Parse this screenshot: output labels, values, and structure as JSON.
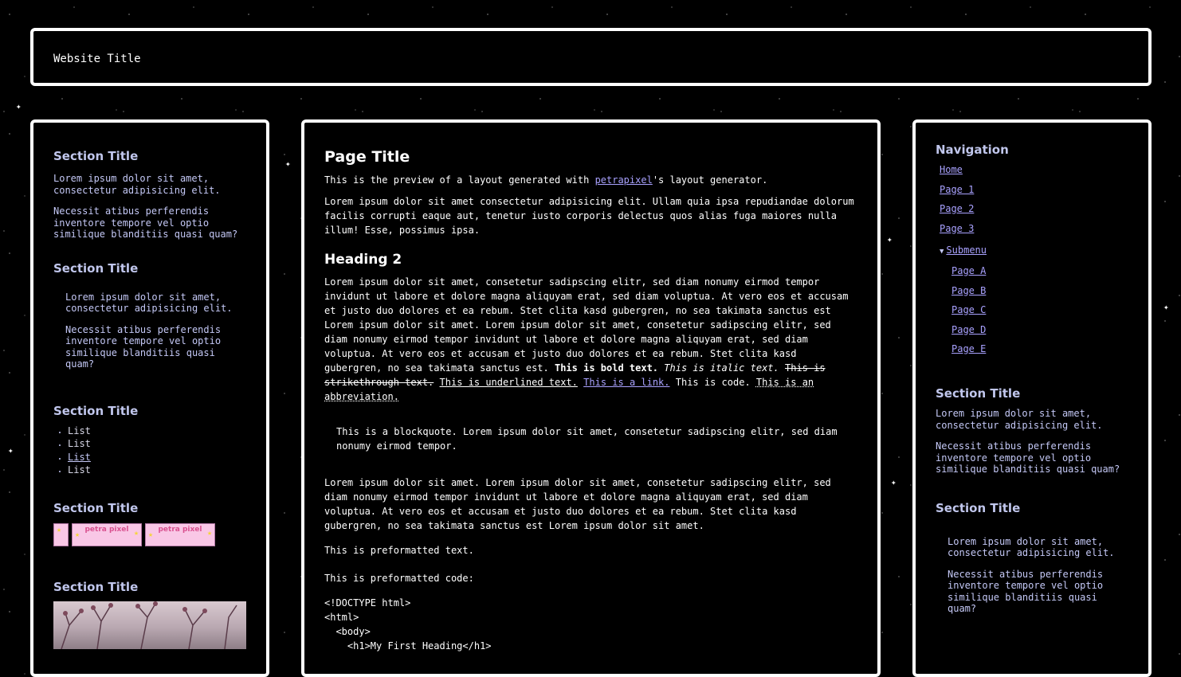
{
  "header": {
    "site_title": "Website Title"
  },
  "left": {
    "s1": {
      "title": "Section Title",
      "p1": "Lorem ipsum dolor sit amet, consectetur adipisicing elit.",
      "p2": "Necessit atibus perferendis inventore tempore vel optio similique blanditiis quasi quam?"
    },
    "s2": {
      "title": "Section Title",
      "p1": "Lorem ipsum dolor sit amet, consectetur adipisicing elit.",
      "p2": "Necessit atibus perferendis inventore tempore vel optio similique blanditiis quasi quam?"
    },
    "s3": {
      "title": "Section Title",
      "items": [
        "List",
        "List",
        "List",
        "List"
      ]
    },
    "s4": {
      "title": "Section Title",
      "buttons": [
        "petra pixel",
        "petra pixel"
      ]
    },
    "s5": {
      "title": "Section Title"
    }
  },
  "main": {
    "page_title": "Page Title",
    "intro_before": "This is the preview of a layout generated with ",
    "intro_link": "petrapixel",
    "intro_after": "'s layout generator.",
    "p1": "Lorem ipsum dolor sit amet consectetur adipisicing elit. Ullam quia ipsa repudiandae dolorum facilis corrupti eaque aut, tenetur iusto corporis delectus quos alias fuga maiores nulla illum! Esse, possimus ipsa.",
    "heading2": "Heading 2",
    "p2_plain": "Lorem ipsum dolor sit amet, consetetur sadipscing elitr, sed diam nonumy eirmod tempor invidunt ut labore et dolore magna aliquyam erat, sed diam voluptua. At vero eos et accusam et justo duo dolores et ea rebum. Stet clita kasd gubergren, no sea takimata sanctus est Lorem ipsum dolor sit amet. Lorem ipsum dolor sit amet, consetetur sadipscing elitr, sed diam nonumy eirmod tempor invidunt ut labore et dolore magna aliquyam erat, sed diam voluptua. At vero eos et accusam et justo duo dolores et ea rebum. Stet clita kasd gubergren, no sea takimata sanctus est. ",
    "bold": "This is bold text.",
    "italic": "This is italic text.",
    "strike": "This is strikethrough text.",
    "underline": "This is underlined text.",
    "link": "This is a link.",
    "code": "This is code.",
    "abbr": "This is an abbreviation.",
    "blockquote": "This is a blockquote. Lorem ipsum dolor sit amet, consetetur sadipscing elitr, sed diam nonumy eirmod tempor.",
    "p3": "Lorem ipsum dolor sit amet. Lorem ipsum dolor sit amet, consetetur sadipscing elitr, sed diam nonumy eirmod tempor invidunt ut labore et dolore magna aliquyam erat, sed diam voluptua. At vero eos et accusam et justo duo dolores et ea rebum. Stet clita kasd gubergren, no sea takimata sanctus est Lorem ipsum dolor sit amet.",
    "pre_text": "This is preformatted text.",
    "pre_code_label": "This is preformatted code:",
    "code_lines": [
      "<!DOCTYPE html>",
      "<html>",
      "  <body>",
      "    <h1>My First Heading</h1>"
    ]
  },
  "right": {
    "nav": {
      "title": "Navigation",
      "items": [
        "Home",
        "Page 1",
        "Page 2",
        "Page 3"
      ],
      "submenu": "Submenu",
      "subitems": [
        "Page A",
        "Page B",
        "Page C",
        "Page D",
        "Page E"
      ]
    },
    "s1": {
      "title": "Section Title",
      "p1": "Lorem ipsum dolor sit amet, consectetur adipisicing elit.",
      "p2": "Necessit atibus perferendis inventore tempore vel optio similique blanditiis quasi quam?"
    },
    "s2": {
      "title": "Section Title",
      "p1": "Lorem ipsum dolor sit amet, consectetur adipisicing elit.",
      "p2": "Necessit atibus perferendis inventore tempore vel optio similique blanditiis quasi quam?"
    }
  }
}
